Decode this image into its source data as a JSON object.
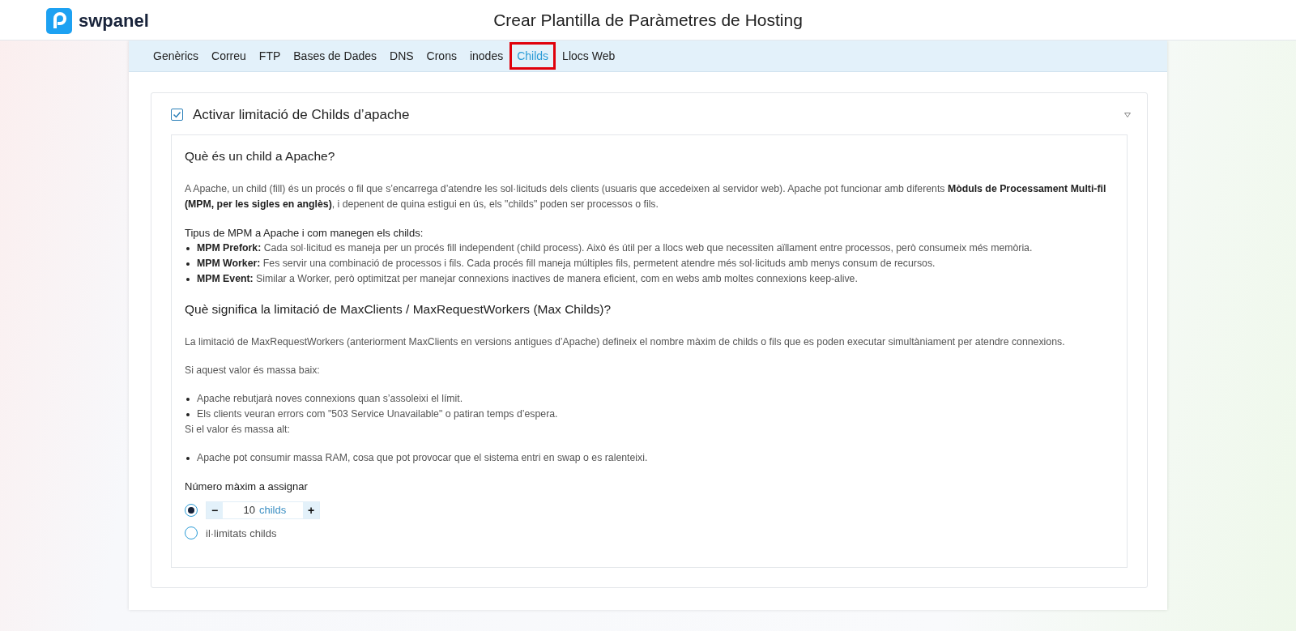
{
  "header": {
    "logo_text": "swpanel",
    "title": "Crear Plantilla de Paràmetres de Hosting"
  },
  "tabs": [
    {
      "label": "Genèrics",
      "selected": false,
      "highlighted": false
    },
    {
      "label": "Correu",
      "selected": false,
      "highlighted": false
    },
    {
      "label": "FTP",
      "selected": false,
      "highlighted": false
    },
    {
      "label": "Bases de Dades",
      "selected": false,
      "highlighted": false
    },
    {
      "label": "DNS",
      "selected": false,
      "highlighted": false
    },
    {
      "label": "Crons",
      "selected": false,
      "highlighted": false
    },
    {
      "label": "inodes",
      "selected": false,
      "highlighted": false
    },
    {
      "label": "Childs",
      "selected": true,
      "highlighted": true
    },
    {
      "label": "Llocs Web",
      "selected": false,
      "highlighted": false
    }
  ],
  "section": {
    "label": "Activar limitació de Childs d’apache",
    "checked": true,
    "expanded": true,
    "blocks": [
      {
        "kind": "heading",
        "text": "Què és un child a Apache?"
      },
      {
        "kind": "paragraph",
        "text": "A Apache, un child (fill) és un procés o fil que s’encarrega d’atendre les sol·licituds dels clients (usuaris que accedeixen al servidor web). Apache pot funcionar amb diferents **Mòduls de Processament Multi-fil (MPM, per les sigles en anglès)**, i depenent de quina estigui en ús, els \"childs\" poden ser processos o fils."
      },
      {
        "kind": "subheading",
        "text": "Tipus de MPM a Apache i com manegen els childs:"
      },
      {
        "kind": "list",
        "items": [
          "**MPM Prefork:** Cada sol·licitud es maneja per un procés fill independent (child process). Això és útil per a llocs web que necessiten aïllament entre processos, però consumeix més memòria.",
          "**MPM Worker:** Fes servir una combinació de processos i fils. Cada procés fill maneja múltiples fils, permetent atendre més sol·licituds amb menys consum de recursos.",
          "**MPM Event:** Similar a Worker, però optimitzat per manejar connexions inactives de manera eficient, com en webs amb moltes connexions keep-alive."
        ]
      },
      {
        "kind": "heading",
        "text": "Què significa la limitació de MaxClients / MaxRequestWorkers (Max Childs)?"
      },
      {
        "kind": "paragraph",
        "text": "La limitació de MaxRequestWorkers (anteriorment MaxClients en versions antigues d’Apache) defineix el nombre màxim de childs o fils que es poden executar simultàniament per atendre connexions."
      },
      {
        "kind": "paragraph",
        "text": "Si aquest valor és massa baix:"
      },
      {
        "kind": "list",
        "items": [
          "Apache rebutjarà noves connexions quan s’assoleixi el límit.",
          "Els clients veuran errors com \"503 Service Unavailable\" o patiran temps d’espera."
        ]
      },
      {
        "kind": "paragraph",
        "text": "Si el valor és massa alt:"
      },
      {
        "kind": "list",
        "items": [
          "Apache pot consumir massa RAM, cosa que pot provocar que el sistema entri en swap o es ralenteixi."
        ]
      }
    ],
    "field_label": "Número màxim a assignar",
    "options": [
      {
        "kind": "stepper",
        "selected": true,
        "minus": "−",
        "value": "10",
        "unit": "childs",
        "plus": "+"
      },
      {
        "kind": "text",
        "selected": false,
        "label": "il·limitats childs"
      }
    ]
  }
}
